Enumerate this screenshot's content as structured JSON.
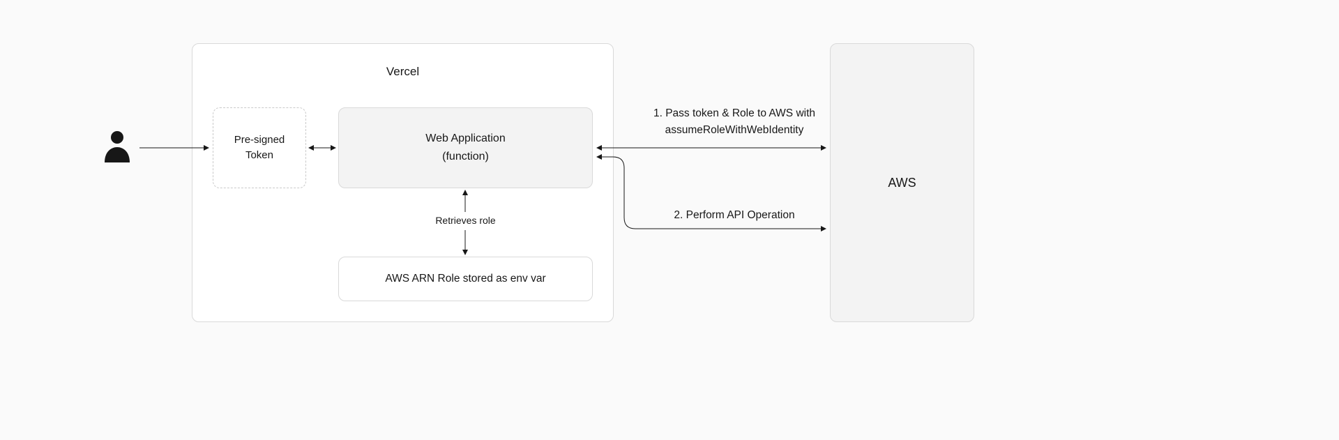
{
  "vercel": {
    "title": "Vercel"
  },
  "aws": {
    "title": "AWS"
  },
  "token": {
    "line1": "Pre-signed",
    "line2": "Token"
  },
  "webapp": {
    "line1": "Web Application",
    "line2": "(function)"
  },
  "retrieves": "Retrieves role",
  "arn": {
    "label": "AWS ARN Role stored as env var"
  },
  "step1": {
    "line1": "1. Pass token & Role to AWS with",
    "line2": "assumeRoleWithWebIdentity"
  },
  "step2": {
    "label": "2. Perform API Operation"
  }
}
